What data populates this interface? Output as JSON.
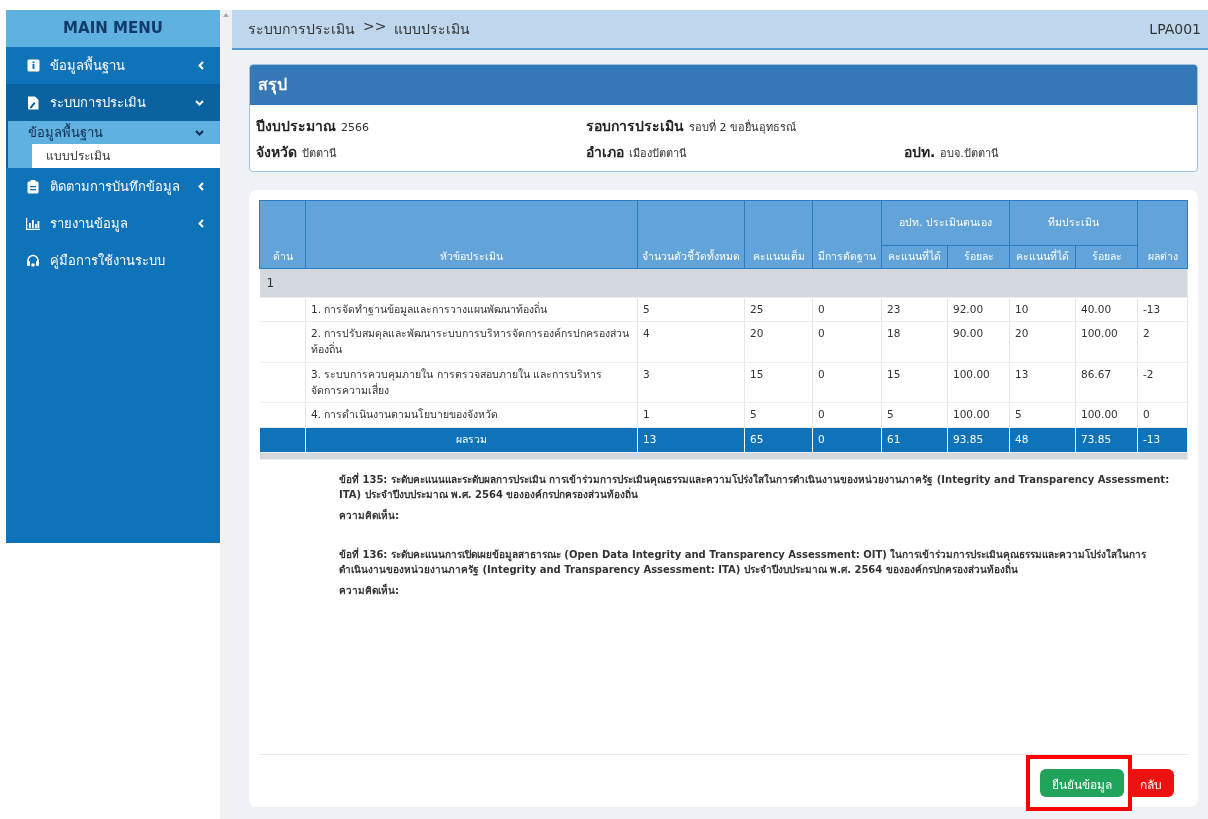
{
  "sidebar": {
    "title": "MAIN MENU",
    "items": [
      {
        "label": "ข้อมูลพื้นฐาน",
        "expanded": false
      },
      {
        "label": "ระบบการประเมิน",
        "expanded": true,
        "children": [
          {
            "label": "ข้อมูลพื้นฐาน",
            "expanded": true,
            "children": [
              {
                "label": "แบบประเมิน",
                "selected": true
              }
            ]
          }
        ]
      },
      {
        "label": "ติดตามการบันทึกข้อมูล",
        "expanded": false
      },
      {
        "label": "รายงานข้อมูล",
        "expanded": false
      },
      {
        "label": "คู่มือการใช้งานระบบ"
      }
    ]
  },
  "header": {
    "breadcrumb": [
      "ระบบการประเมิน",
      ">>",
      "แบบประเมิน"
    ],
    "code": "LPA001"
  },
  "summary": {
    "title": "สรุป",
    "fields": [
      {
        "label": "ปีงบประมาณ",
        "value": "2566"
      },
      {
        "label": "รอบการประเมิน",
        "value": "รอบที่ 2 ขอยื่นอุทธรณ์"
      },
      {
        "label": "จังหวัด",
        "value": "ปัตตานี"
      },
      {
        "label": "อำเภอ",
        "value": "เมืองปัตตานี"
      },
      {
        "label": "อปท.",
        "value": "อบจ.ปัตตานี"
      }
    ]
  },
  "table": {
    "header_rows": [
      [
        {
          "text": "ด้าน",
          "rowspan": 2
        },
        {
          "text": "หัวข้อประเมิน",
          "rowspan": 2
        },
        {
          "text": "จำนวนตัวชี้วัดทั้งหมด",
          "rowspan": 2
        },
        {
          "text": "คะแนนเต็ม",
          "rowspan": 2
        },
        {
          "text": "มีการตัดฐาน",
          "rowspan": 2
        },
        {
          "text": "อปท. ประเมินตนเอง",
          "colspan": 2
        },
        {
          "text": "ทีมประเมิน",
          "colspan": 2
        },
        {
          "text": "ผลต่าง",
          "rowspan": 2
        }
      ],
      [
        {
          "text": "คะแนนที่ได้"
        },
        {
          "text": "ร้อยละ"
        },
        {
          "text": "คะแนนที่ได้"
        },
        {
          "text": "ร้อยละ"
        }
      ]
    ],
    "rows": [
      {
        "kind": "group",
        "cells": [
          {
            "text": "1",
            "colspan": 10
          }
        ]
      },
      {
        "kind": "item",
        "cells": [
          "",
          "1. การจัดทำฐานข้อมูลและการวางแผนพัฒนาท้องถิ่น",
          "5",
          "25",
          "0",
          "23",
          "92.00",
          "10",
          "40.00",
          "-13"
        ]
      },
      {
        "kind": "item",
        "cells": [
          "",
          "2. การปรับสมดุลและพัฒนาระบบการบริหารจัดการองค์กรปกครองส่วนท้องถิ่น",
          "4",
          "20",
          "0",
          "18",
          "90.00",
          "20",
          "100.00",
          "2"
        ]
      },
      {
        "kind": "item",
        "cells": [
          "",
          "3. ระบบการควบคุมภายใน การตรวจสอบภายใน และการบริหารจัดการความเสี่ยง",
          "3",
          "15",
          "0",
          "15",
          "100.00",
          "13",
          "86.67",
          "-2"
        ]
      },
      {
        "kind": "item",
        "cells": [
          "",
          "4. การดำเนินงานตามนโยบายของจังหวัด",
          "1",
          "5",
          "0",
          "5",
          "100.00",
          "5",
          "100.00",
          "0"
        ]
      },
      {
        "kind": "total",
        "cells": [
          "",
          "ผลรวม",
          "13",
          "65",
          "0",
          "61",
          "93.85",
          "48",
          "73.85",
          "-13"
        ]
      },
      {
        "kind": "spacer",
        "cells": []
      }
    ]
  },
  "notes": [
    {
      "text": "ข้อที่ 135: ระดับคะแนนและระดับผลการประเมิน การเข้าร่วมการประเมินคุณธรรมและความโปร่งใสในการดำเนินงานของหน่วยงานภาครัฐ (Integrity and Transparency Assessment: ITA) ประจำปีงบประมาณ พ.ศ. 2564 ขององค์กรปกครองส่วนท้องถิ่น",
      "comment_label": "ความคิดเห็น:"
    },
    {
      "text": "ข้อที่ 136: ระดับคะแนนการเปิดเผยข้อมูลสาธารณะ (Open Data Integrity and Transparency Assessment: OIT) ในการเข้าร่วมการประเมินคุณธรรมและความโปร่งใสในการดำเนินงานของหน่วยงานภาครัฐ (Integrity and Transparency Assessment: ITA) ประจำปีงบประมาณ พ.ศ. 2564 ขององค์กรปกครองส่วนท้องถิ่น",
      "comment_label": "ความคิดเห็น:"
    }
  ],
  "buttons": [
    {
      "label": "ยืนยันข้อมูล",
      "kind": "confirm",
      "highlighted": true
    },
    {
      "label": "กลับ",
      "kind": "back",
      "highlighted": false
    }
  ]
}
